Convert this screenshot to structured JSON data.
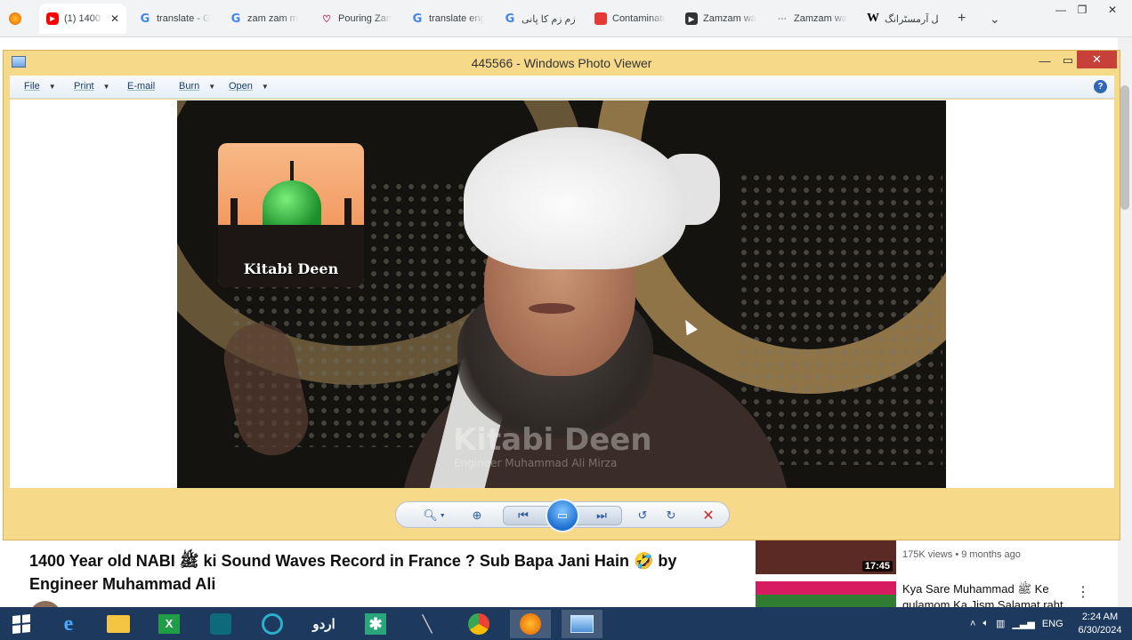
{
  "browser": {
    "tabs": [
      {
        "label": "(1) 1400 Y",
        "icon": "youtube-icon",
        "active": true
      },
      {
        "label": "translate - G",
        "icon": "google-icon"
      },
      {
        "label": "zam zam m",
        "icon": "google-icon"
      },
      {
        "label": "Pouring Zam",
        "icon": "site-icon"
      },
      {
        "label": "translate eng",
        "icon": "google-icon"
      },
      {
        "label": "زم زم کا پانی",
        "icon": "google-icon"
      },
      {
        "label": "Contaminate",
        "icon": "site-icon"
      },
      {
        "label": "Zamzam wa",
        "icon": "site-icon"
      },
      {
        "label": "Zamzam wa",
        "icon": "site-icon"
      },
      {
        "label": "نیل آرمسٹرانگ",
        "icon": "wikipedia-icon"
      }
    ],
    "new_tab": "+",
    "tab_list": "⌄"
  },
  "photo_viewer": {
    "title": "445566 - Windows Photo Viewer",
    "menu": [
      "File",
      "Print",
      "E-mail",
      "Burn",
      "Open"
    ],
    "help": "?",
    "image": {
      "logo_text": "Kitabi Deen",
      "watermark_title": "Kitabi Deen",
      "watermark_subtitle": "Engineer Muhammad Ali Mirza"
    },
    "controls": [
      "zoom-icon",
      "actual-size-icon",
      "previous-icon",
      "slideshow-icon",
      "next-icon",
      "rotate-ccw-icon",
      "rotate-cw-icon",
      "delete-icon"
    ]
  },
  "youtube": {
    "video_title": "1400 Year old NABI ﷺ ki Sound Waves Record in France ? Sub Bapa Jani Hain 🤣 by Engineer Muhammad Ali",
    "recommended": [
      {
        "duration": "17:45",
        "views": "175K views",
        "age": "9 months ago"
      },
      {
        "title": "Kya Sare Muhammad ﷺ Ke gulamom Ka Jism Salamat raht"
      }
    ]
  },
  "taskbar": {
    "language": "ENG",
    "time": "2:24 AM",
    "date": "6/30/2024",
    "urdu_label": "اردو"
  }
}
